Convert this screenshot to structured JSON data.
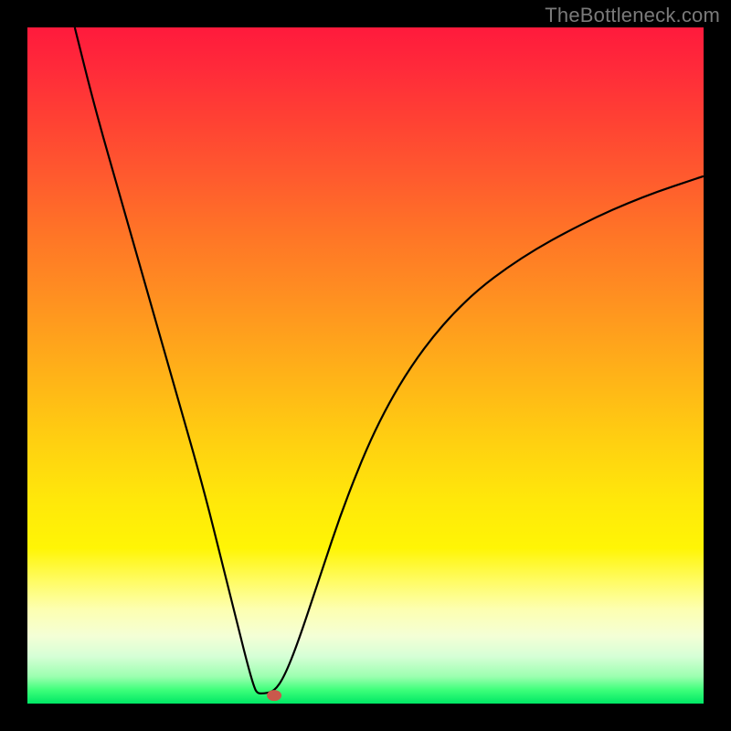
{
  "watermark": "TheBottleneck.com",
  "chart_data": {
    "type": "line",
    "title": "",
    "xlabel": "",
    "ylabel": "",
    "x_range": [
      0,
      100
    ],
    "y_range": [
      0,
      100
    ],
    "curve_points": [
      {
        "x": 7,
        "y": 100
      },
      {
        "x": 10,
        "y": 88
      },
      {
        "x": 14,
        "y": 74
      },
      {
        "x": 18,
        "y": 60
      },
      {
        "x": 22,
        "y": 46
      },
      {
        "x": 26,
        "y": 32
      },
      {
        "x": 29,
        "y": 20
      },
      {
        "x": 31,
        "y": 12
      },
      {
        "x": 32.5,
        "y": 6
      },
      {
        "x": 33.5,
        "y": 2.5
      },
      {
        "x": 34,
        "y": 1.5
      },
      {
        "x": 35,
        "y": 1.5
      },
      {
        "x": 36.5,
        "y": 1.8
      },
      {
        "x": 38,
        "y": 4
      },
      {
        "x": 40,
        "y": 9
      },
      {
        "x": 43,
        "y": 18
      },
      {
        "x": 47,
        "y": 30
      },
      {
        "x": 52,
        "y": 42
      },
      {
        "x": 58,
        "y": 52
      },
      {
        "x": 65,
        "y": 60
      },
      {
        "x": 73,
        "y": 66
      },
      {
        "x": 82,
        "y": 71
      },
      {
        "x": 91,
        "y": 75
      },
      {
        "x": 100,
        "y": 78
      }
    ],
    "marker": {
      "x": 36.5,
      "y": 1.2
    },
    "gradient_description": "vertical gradient from red (top, high bottleneck) through orange/yellow to green (bottom, low bottleneck)",
    "colors": {
      "top": "#ff1a3c",
      "mid": "#ffd210",
      "bottom": "#00e765"
    }
  }
}
